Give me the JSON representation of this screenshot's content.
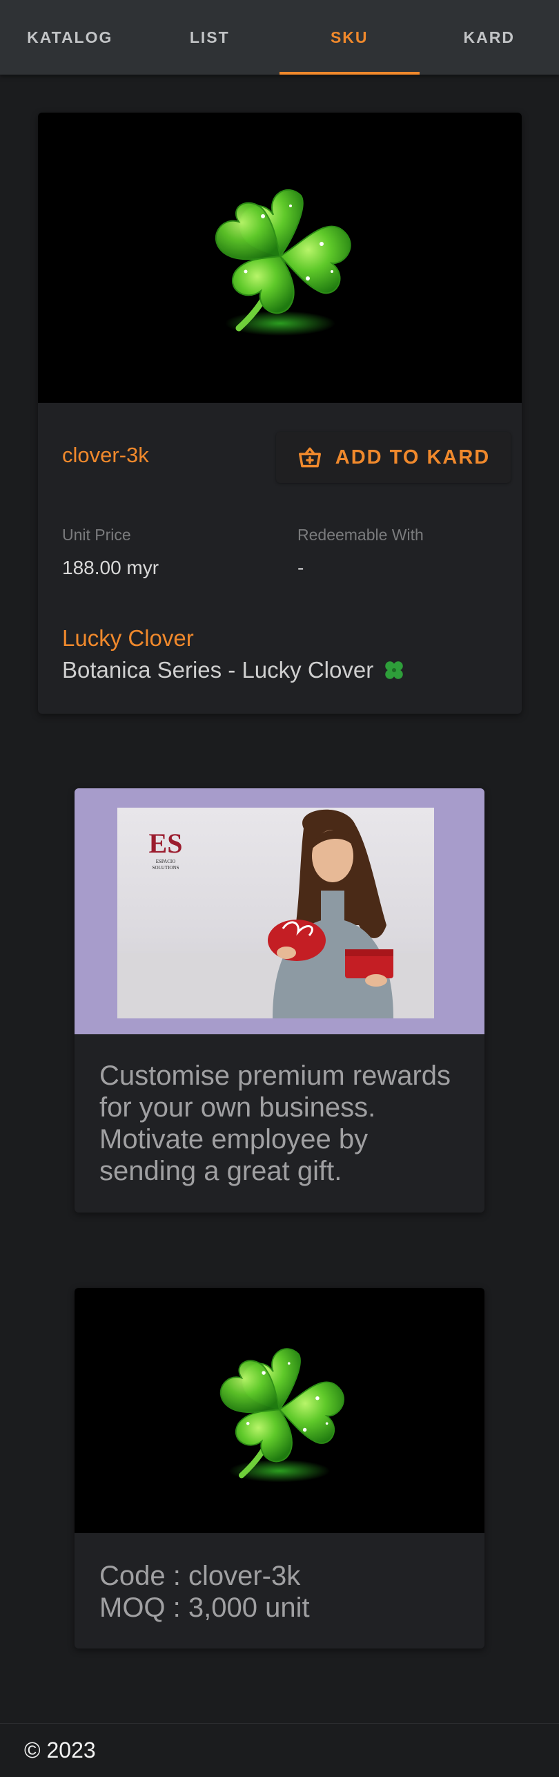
{
  "tabs": [
    {
      "label": "KATALOG",
      "active": false
    },
    {
      "label": "LIST",
      "active": false
    },
    {
      "label": "SKU",
      "active": true
    },
    {
      "label": "KARD",
      "active": false
    }
  ],
  "accent_color": "#f0892c",
  "product": {
    "image_icon": "four-leaf-clover",
    "sku_code": "clover-3k",
    "add_button_label": "ADD TO KARD",
    "add_button_icon": "basket-icon",
    "unit_price_label": "Unit Price",
    "unit_price_value": "188.00 myr",
    "redeemable_label": "Redeemable With",
    "redeemable_value": "-",
    "name": "Lucky Clover",
    "description": "Botanica Series - Lucky Clover"
  },
  "promo": {
    "logo_letters": "ES",
    "logo_text": "ESPACIO SOLUTIONS",
    "text": "Customise premium rewards for your own business. Motivate employee by sending a great gift."
  },
  "details": {
    "code_line": "Code : clover-3k",
    "moq_line": "MOQ : 3,000 unit"
  },
  "footer": {
    "copyright": "© 2023"
  }
}
